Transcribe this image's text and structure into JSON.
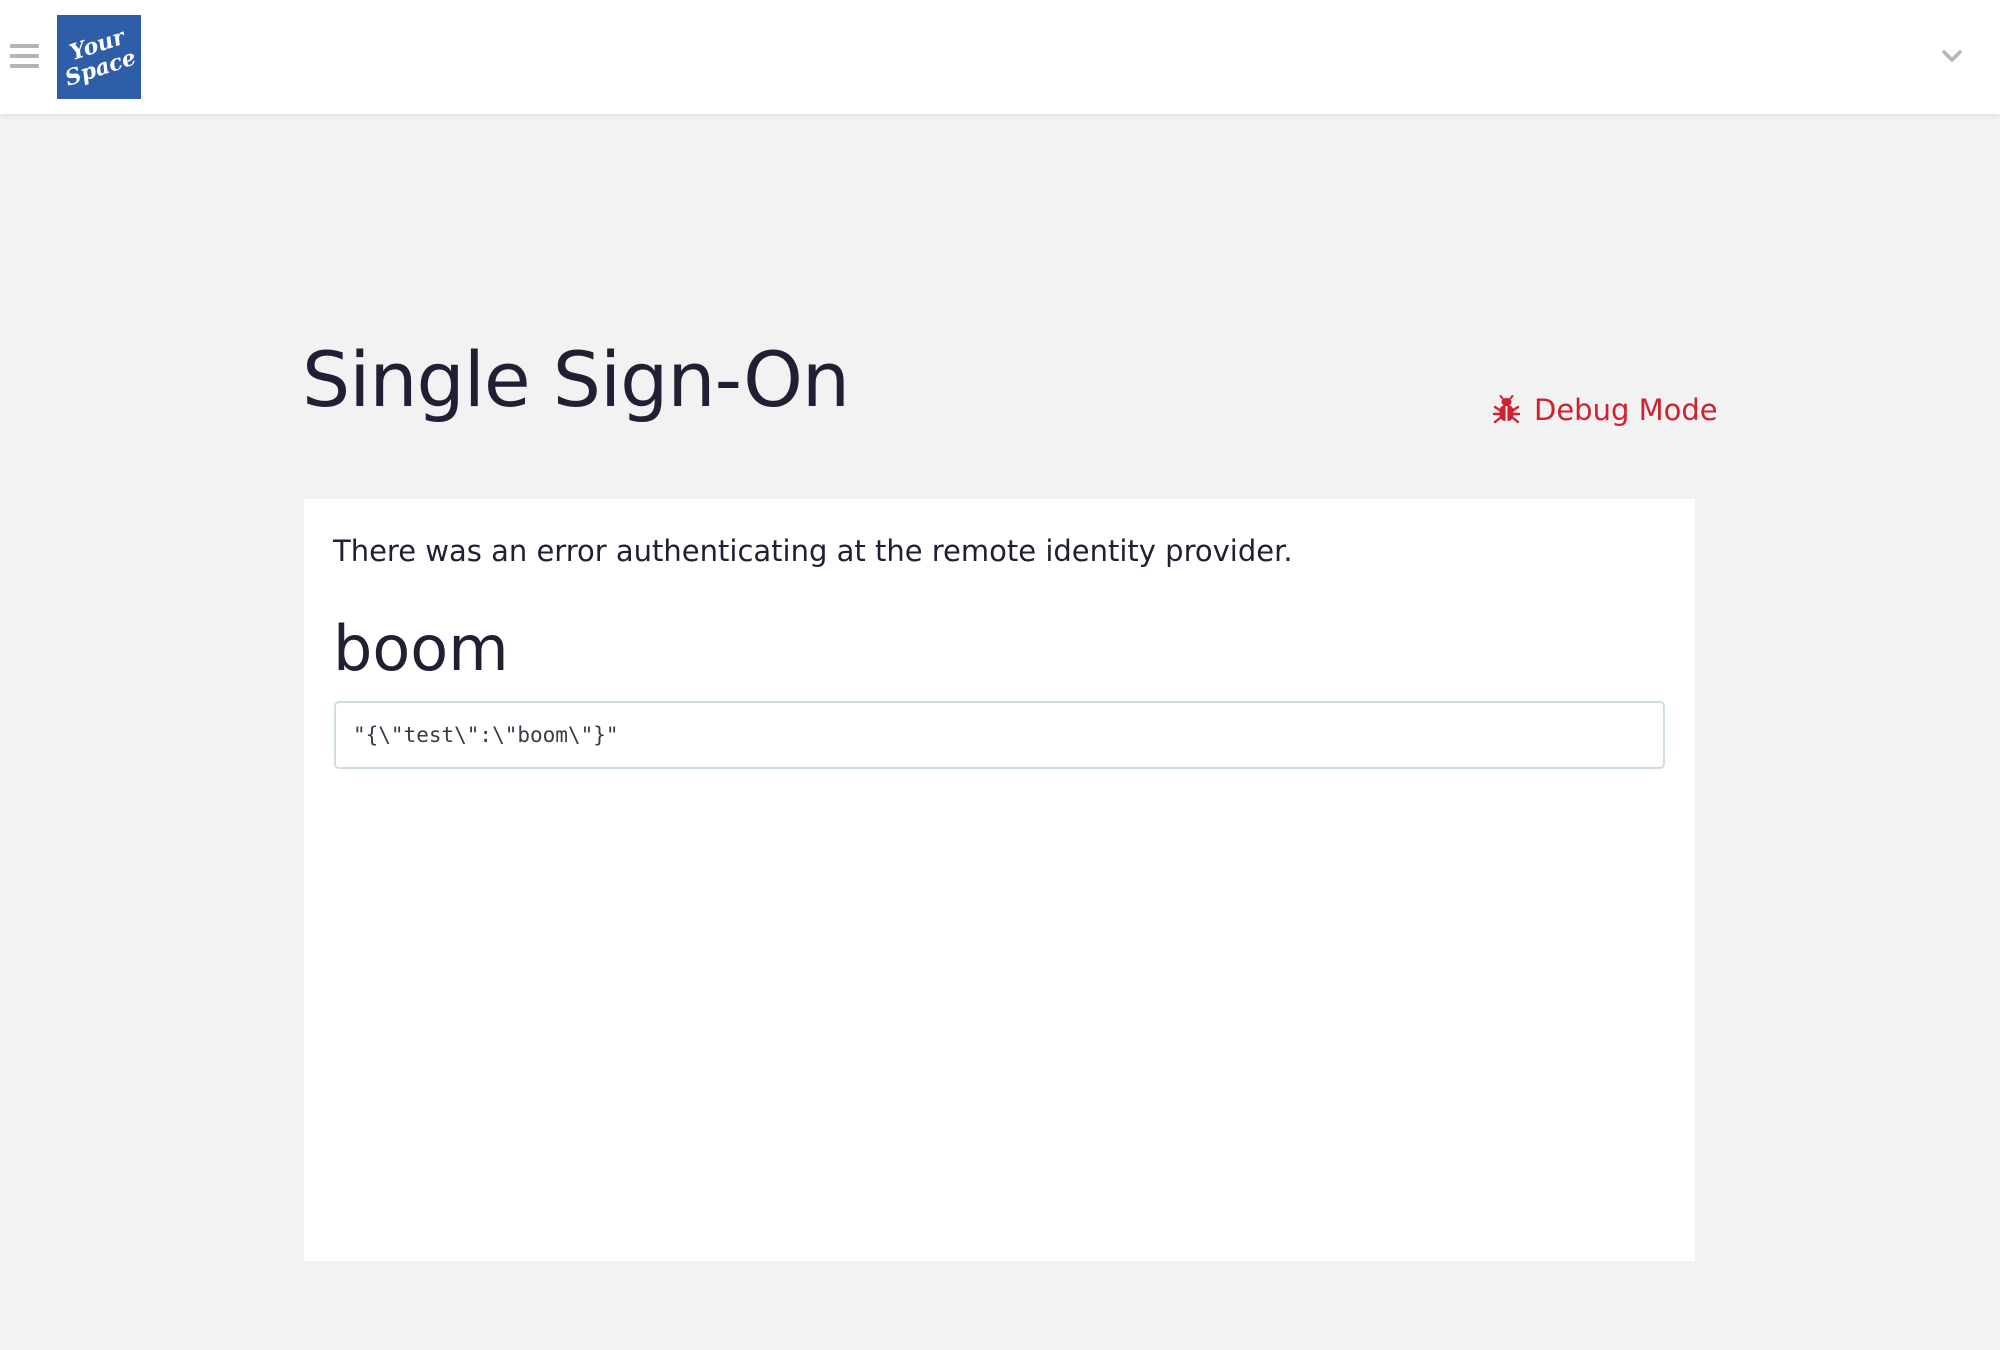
{
  "topbar": {
    "menu_icon": "hamburger-menu-icon",
    "logo": {
      "text_line1": "Your",
      "text_line2": "Space",
      "background": "#2f5ea8"
    },
    "account_icon": "chevron-down-icon"
  },
  "page": {
    "title": "Single Sign-On",
    "debug": {
      "icon": "bug-icon",
      "label": "Debug Mode",
      "color": "#d0212f"
    }
  },
  "error": {
    "message": "There was an error authenticating at the remote identity provider.",
    "heading": "boom",
    "details": "\"{\\\"test\\\":\\\"boom\\\"}\""
  }
}
